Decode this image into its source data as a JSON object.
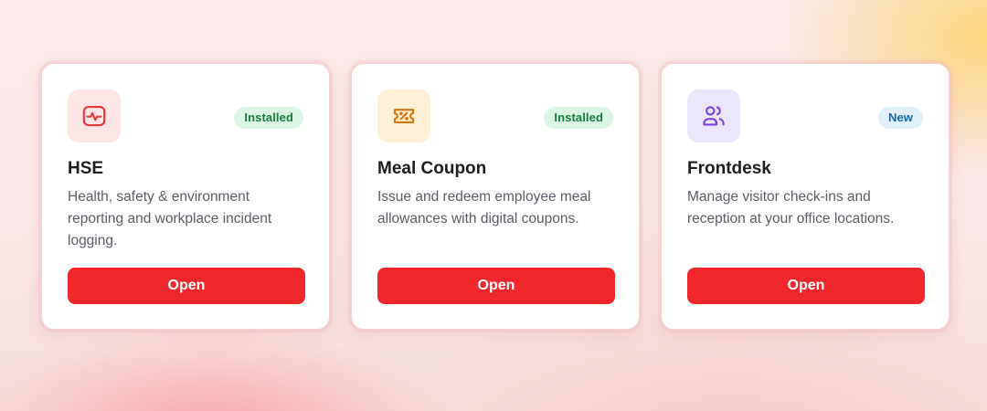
{
  "cards": [
    {
      "title": "HSE",
      "description": "Health, safety & environment reporting and workplace incident logging.",
      "badge": "Installed",
      "button_label": "Open",
      "icon": "health-monitor-icon",
      "colors": {
        "tile": "#fde4e5",
        "icon": "#e8363b",
        "badge_bg": "#daf5e4",
        "badge_text": "#1a7a3e"
      }
    },
    {
      "title": "Meal Coupon",
      "description": "Issue and redeem employee meal allowances with digital coupons.",
      "badge": "Installed",
      "button_label": "Open",
      "icon": "coupon-ticket-icon",
      "colors": {
        "tile": "#fdf0d5",
        "icon": "#d9740f",
        "badge_bg": "#daf5e4",
        "badge_text": "#1a7a3e"
      }
    },
    {
      "title": "Frontdesk",
      "description": "Manage visitor check-ins and reception at your office locations.",
      "badge": "New",
      "button_label": "Open",
      "icon": "users-icon",
      "colors": {
        "tile": "#ece6fd",
        "icon": "#7b3fe4",
        "badge_bg": "#dff0fb",
        "badge_text": "#1769a8"
      }
    }
  ],
  "colors": {
    "button": "#f0282c",
    "button_text": "#ffffff"
  }
}
